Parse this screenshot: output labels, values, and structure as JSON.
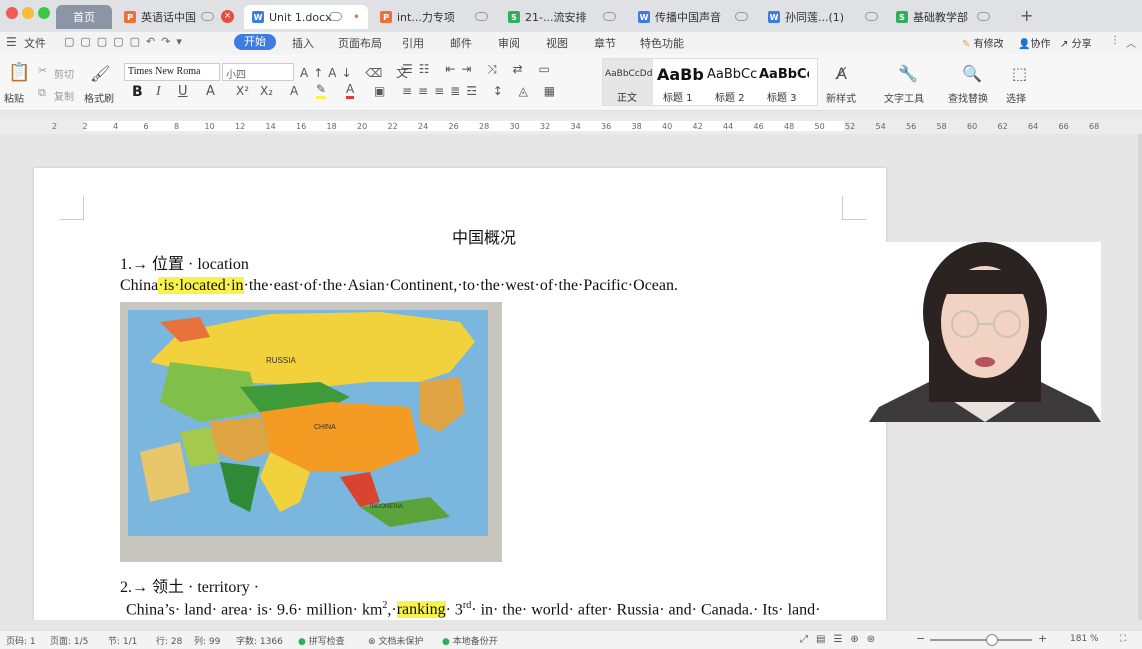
{
  "titlebar": {
    "tabs": [
      {
        "label": "首页",
        "type": "home"
      },
      {
        "label": "英语话中国",
        "type": "ppt"
      },
      {
        "label": "Unit 1.docx",
        "type": "word",
        "active": true
      },
      {
        "label": "int...力专项",
        "type": "ppt"
      },
      {
        "label": "21-...流安排",
        "type": "sheet"
      },
      {
        "label": "传播中国声音",
        "type": "word"
      },
      {
        "label": "孙同莲...(1)",
        "type": "word"
      },
      {
        "label": "基础教学部",
        "type": "sheet"
      }
    ],
    "add_tab": "+"
  },
  "menubar": {
    "file": "文件",
    "items": [
      "开始",
      "插入",
      "页面布局",
      "引用",
      "邮件",
      "审阅",
      "视图",
      "章节",
      "特色功能"
    ],
    "right": [
      "有修改",
      "协作",
      "分享"
    ]
  },
  "ribbon": {
    "paste": "粘贴",
    "cut": "剪切",
    "copy": "复制",
    "format_painter": "格式刷",
    "font_name": "Times New Roma",
    "font_size": "小四",
    "styles": [
      {
        "preview": "AaBbCcDd",
        "label": "正文"
      },
      {
        "preview": "AaBb",
        "label": "标题 1"
      },
      {
        "preview": "AaBbCc",
        "label": "标题 2"
      },
      {
        "preview": "AaBbCc",
        "label": "标题 3"
      }
    ],
    "new_style": "新样式",
    "text_tools": "文字工具",
    "find_replace": "查找替换",
    "select": "选择"
  },
  "ruler": [
    "2",
    "2",
    "4",
    "6",
    "8",
    "10",
    "12",
    "14",
    "16",
    "18",
    "20",
    "22",
    "24",
    "26",
    "28",
    "30",
    "32",
    "34",
    "36",
    "38",
    "40",
    "42",
    "44",
    "46",
    "48",
    "50",
    "52",
    "54",
    "56",
    "58",
    "60",
    "62",
    "64",
    "66",
    "68"
  ],
  "document": {
    "title": "中国概况",
    "sec1_heading": "1.→ 位置 · location",
    "sec1_pre": "China",
    "sec1_hl": "·is·located·in",
    "sec1_post": "·the·east·of·the·Asian·Continent,·to·the·west·of·the·Pacific·Ocean.",
    "map_labels": {
      "russia": "RUSSIA",
      "china": "CHINA",
      "indonesia": "INDONESIA"
    },
    "sec2_heading": "2.→ 领土 · territory ·",
    "sec2_a": "China’s· land· area· is· 9.6· million· km",
    "sec2_sup": "2",
    "sec2_b": ",·",
    "sec2_hl": "ranking",
    "sec2_c": "· 3",
    "sec2_sup2": "rd",
    "sec2_d": "· in· the· world· after· Russia· and· Canada.· Its· land·"
  },
  "status": {
    "page_no": "页码: 1",
    "pages": "页面: 1/5",
    "section": "节: 1/1",
    "row": "行: 28",
    "col": "列: 99",
    "words": "字数: 1366",
    "spell": "拼写检查",
    "protect": "文档未保护",
    "backup": "本地备份开",
    "zoom": "181 %"
  }
}
